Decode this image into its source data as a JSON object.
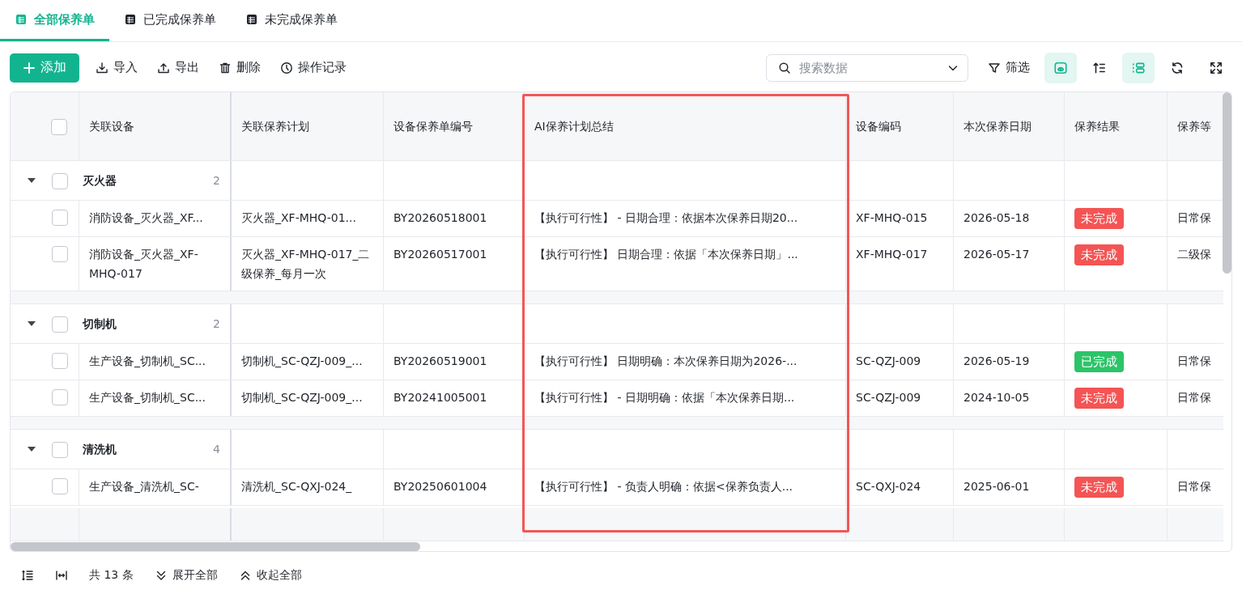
{
  "tabs": [
    {
      "label": "全部保养单",
      "selected": true
    },
    {
      "label": "已完成保养单",
      "selected": false
    },
    {
      "label": "未完成保养单",
      "selected": false
    }
  ],
  "toolbar": {
    "actions": [
      {
        "kind": "add",
        "label": "添加"
      },
      {
        "kind": "import",
        "label": "导入"
      },
      {
        "kind": "export",
        "label": "导出"
      },
      {
        "kind": "delete",
        "label": "删除"
      },
      {
        "kind": "history",
        "label": "操作记录"
      }
    ],
    "search": {
      "placeholder": "搜索数据"
    },
    "filter": {
      "label": "筛选"
    },
    "tools": [
      {
        "kind": "card-view",
        "on": true
      },
      {
        "kind": "sort",
        "on": false
      },
      {
        "kind": "group",
        "on": true
      },
      {
        "kind": "refresh",
        "on": false
      },
      {
        "kind": "fullscreen",
        "on": false
      }
    ]
  },
  "table": {
    "all_checked": false,
    "columns": [
      "关联设备",
      "关联保养计划",
      "设备保养单编号",
      "AI保养计划总结",
      "设备编码",
      "本次保养日期",
      "保养结果",
      "保养等"
    ],
    "groups": [
      {
        "name": "灭火器",
        "count": "2",
        "expanded": true,
        "checked": false,
        "rows": [
          {
            "checked": false,
            "cells": [
              "消防设备_灭火器_XF...",
              "灭火器_XF-MHQ-01...",
              "BY20260518001",
              "【执行可行性】 - 日期合理：依据本次保养日期20...",
              "XF-MHQ-015",
              "2026-05-18"
            ],
            "result": {
              "label": "未完成",
              "kind": "pending"
            },
            "level": "日常保"
          },
          {
            "checked": false,
            "cells": [
              "消防设备_灭火器_XF-MHQ-017",
              "灭火器_XF-MHQ-017_二级保养_每月一次",
              "BY20260517001",
              "【执行可行性】 日期合理：依据「本次保养日期」...",
              "XF-MHQ-017",
              "2026-05-17"
            ],
            "result": {
              "label": "未完成",
              "kind": "pending"
            },
            "level": "二级保"
          }
        ]
      },
      {
        "name": "切制机",
        "count": "2",
        "expanded": true,
        "checked": false,
        "rows": [
          {
            "checked": false,
            "cells": [
              "生产设备_切制机_SC...",
              "切制机_SC-QZJ-009_...",
              "BY20260519001",
              "【执行可行性】 日期明确：本次保养日期为2026-...",
              "SC-QZJ-009",
              "2026-05-19"
            ],
            "result": {
              "label": "已完成",
              "kind": "done"
            },
            "level": "日常保"
          },
          {
            "checked": false,
            "cells": [
              "生产设备_切制机_SC...",
              "切制机_SC-QZJ-009_...",
              "BY20241005001",
              "【执行可行性】 - 日期明确：依据「本次保养日期...",
              "SC-QZJ-009",
              "2024-10-05"
            ],
            "result": {
              "label": "未完成",
              "kind": "pending"
            },
            "level": "日常保"
          }
        ]
      },
      {
        "name": "清洗机",
        "count": "4",
        "expanded": true,
        "checked": false,
        "rows": [
          {
            "checked": false,
            "cells": [
              "生产设备_清洗机_SC-",
              "清洗机_SC-QXJ-024_",
              "BY20250601004",
              "【执行可行性】 - 负责人明确：依据<保养负责人...",
              "SC-QXJ-024",
              "2025-06-01"
            ],
            "result": {
              "label": "未完成",
              "kind": "pending"
            },
            "level": "日常保"
          }
        ]
      }
    ]
  },
  "footer": {
    "total": "共 13 条",
    "expand_all": "展开全部",
    "collapse_all": "收起全部"
  }
}
